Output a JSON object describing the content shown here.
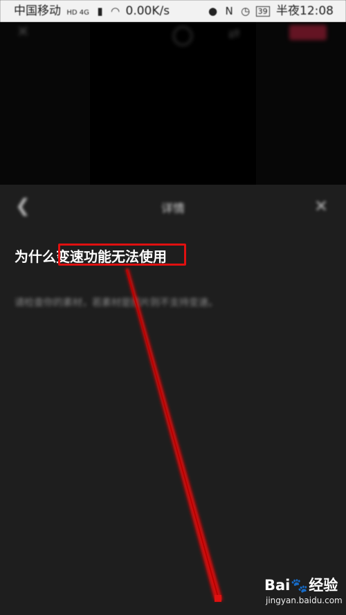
{
  "status_bar": {
    "carrier": "中国移动",
    "network_badge": "HD 4G",
    "speed": "0.00K/s",
    "battery": "39",
    "time": "半夜12:08"
  },
  "panel": {
    "title": "详情",
    "question_prefix": "为什么",
    "question_highlight": "变速功能无法使用",
    "answer": "请检查你的素材，若素材是图片则不支持变速。"
  },
  "watermark": {
    "brand_left": "Bai",
    "brand_right": "经验",
    "url": "jingyan.baidu.com"
  },
  "colors": {
    "annotation_red": "#e01010",
    "panel_bg": "#1e1e1e"
  }
}
